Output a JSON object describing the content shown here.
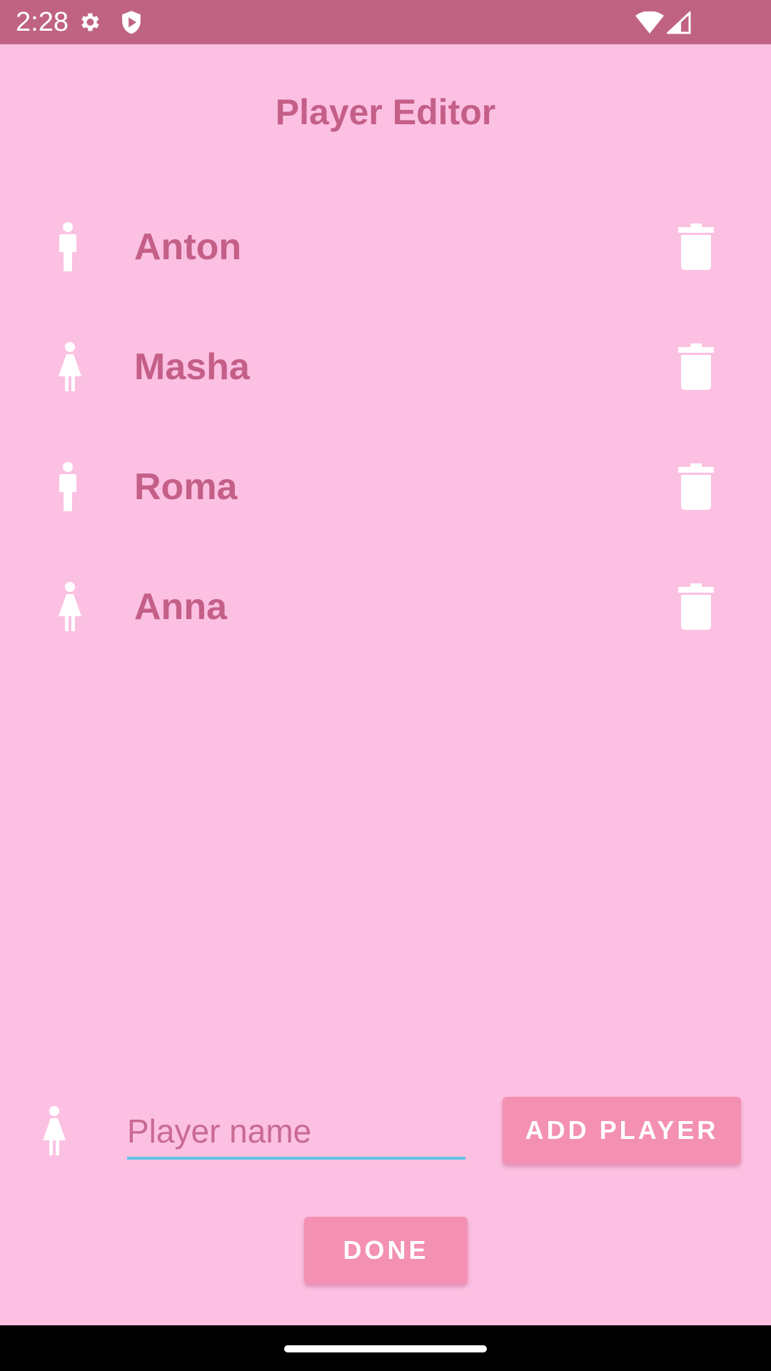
{
  "status_bar": {
    "time": "2:28",
    "icons": [
      "gear-icon",
      "shield-play-icon",
      "wifi-icon",
      "signal-icon"
    ],
    "background": "#c06383"
  },
  "title": "Player Editor",
  "players": [
    {
      "name": "Anton",
      "gender_icon": "male-icon"
    },
    {
      "name": "Masha",
      "gender_icon": "female-icon"
    },
    {
      "name": "Roma",
      "gender_icon": "male-icon"
    },
    {
      "name": "Anna",
      "gender_icon": "female-icon"
    }
  ],
  "new_player": {
    "gender_icon": "female-icon",
    "placeholder": "Player name",
    "value": ""
  },
  "buttons": {
    "add_player": "ADD PLAYER",
    "done": "DONE"
  },
  "colors": {
    "background": "#fcc0e2",
    "text": "#c45f88",
    "button": "#f490b2",
    "input_underline": "#5ec4e6"
  }
}
